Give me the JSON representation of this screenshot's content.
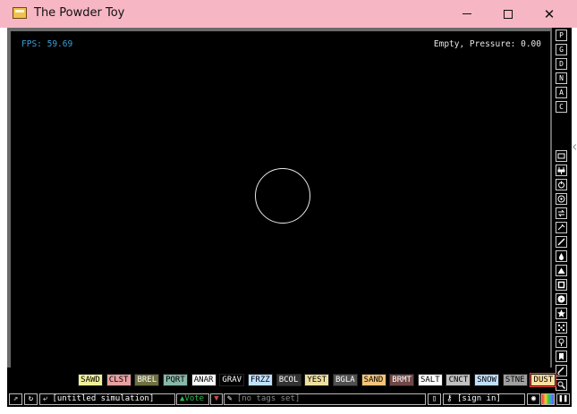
{
  "window": {
    "title": "The Powder Toy",
    "controls": {
      "minimize": "minimize",
      "maximize": "maximize",
      "close": "close"
    }
  },
  "hud": {
    "fps": "FPS: 59.69",
    "status": "Empty,  Pressure: 0.00"
  },
  "right_toolbar": {
    "mode_buttons": [
      "P",
      "G",
      "D",
      "N",
      "A",
      "C"
    ],
    "category_icons": [
      "text-icon",
      "electronics-icon",
      "power-icon",
      "sensors-icon",
      "force-icon",
      "explosives-icon",
      "gases-icon",
      "liquids-icon",
      "powders-icon",
      "solids-icon",
      "radioactive-icon",
      "special-icon",
      "game-of-life-icon",
      "tools-icon",
      "favorites-icon",
      "decorations-icon",
      "search-icon"
    ]
  },
  "elements": [
    {
      "label": "SAWD",
      "color": "#f0f09a"
    },
    {
      "label": "CLST",
      "color": "#e8a0a0"
    },
    {
      "label": "BREL",
      "color": "#707040"
    },
    {
      "label": "PQRT",
      "color": "#88b8a8"
    },
    {
      "label": "ANAR",
      "color": "#ffffff"
    },
    {
      "label": "GRAV",
      "color": "#000000"
    },
    {
      "label": "FRZZ",
      "color": "#c0e0ff"
    },
    {
      "label": "BCOL",
      "color": "#333333"
    },
    {
      "label": "YEST",
      "color": "#f0e0a0"
    },
    {
      "label": "BGLA",
      "color": "#505050"
    },
    {
      "label": "SAND",
      "color": "#f4c478"
    },
    {
      "label": "BRMT",
      "color": "#704848"
    },
    {
      "label": "SALT",
      "color": "#ffffff"
    },
    {
      "label": "CNCT",
      "color": "#c0c0c0"
    },
    {
      "label": "SNOW",
      "color": "#c0e0ff"
    },
    {
      "label": "STNE",
      "color": "#a0a0a0"
    },
    {
      "label": "DUST",
      "color": "#ffe0a0"
    }
  ],
  "bottom_bar": {
    "simulation_name": "[untitled simulation]",
    "vote_label": "Vote",
    "tags_placeholder": "[no tags set]",
    "sign_in": "[sign in]"
  }
}
